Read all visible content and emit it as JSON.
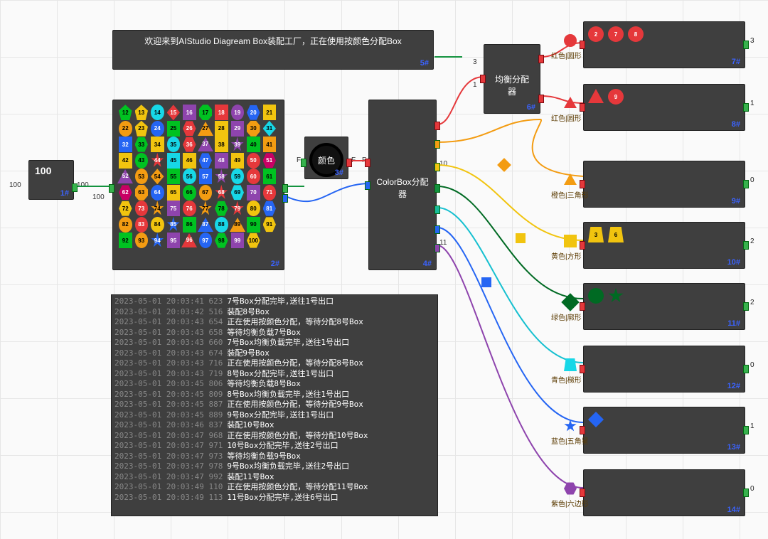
{
  "banner": {
    "text": "欢迎来到AIStudio Diagream Box装配工厂，正在使用按颜色分配Box",
    "id": "5#"
  },
  "source_node": {
    "value": "100",
    "label_left": "100",
    "label_right": "100",
    "port_right_bottom": "100",
    "id": "1#"
  },
  "factory_node": {
    "id": "2#"
  },
  "color_node": {
    "label": "颜色",
    "left_letter": "F",
    "right_letter": "F",
    "left2_letter": "F",
    "id": "3#"
  },
  "distributor": {
    "title": "ColorBox分配器",
    "id": "4#",
    "in_top": "10",
    "in_bottom": "11"
  },
  "balancer": {
    "title": "均衡分配器",
    "id": "6#",
    "in_top": "3",
    "in_bottom": "1"
  },
  "outputs": [
    {
      "id": "7#",
      "label": "红色|圆形",
      "right": "3",
      "marker": "red-circle",
      "shapes": [
        {
          "t": "circle",
          "c": "c-red",
          "n": "2"
        },
        {
          "t": "circle",
          "c": "c-red",
          "n": "7"
        },
        {
          "t": "circle",
          "c": "c-red",
          "n": "8"
        }
      ]
    },
    {
      "id": "8#",
      "label": "红色|圆形",
      "right": "1",
      "marker": "red-triangle",
      "shapes": [
        {
          "t": "triangle-up",
          "c": "c-red",
          "n": ""
        },
        {
          "t": "circle",
          "c": "c-red",
          "n": "9"
        }
      ]
    },
    {
      "id": "9#",
      "label": "橙色|三角形",
      "right": "0",
      "marker": "orange-triangle",
      "shapes": []
    },
    {
      "id": "10#",
      "label": "黄色|方形",
      "right": "2",
      "marker": "yellow-square",
      "shapes": [
        {
          "t": "trapezoid",
          "c": "c-yellow",
          "n": "3"
        },
        {
          "t": "trapezoid",
          "c": "c-yellow",
          "n": "6"
        }
      ]
    },
    {
      "id": "11#",
      "label": "绿色|廓形",
      "right": "2",
      "marker": "darkgreen-diamond",
      "shapes": [
        {
          "t": "circle",
          "c": "c-darkgreen",
          "n": ""
        },
        {
          "t": "star",
          "c": "c-darkgreen",
          "n": ""
        }
      ]
    },
    {
      "id": "12#",
      "label": "青色|梯形",
      "right": "0",
      "marker": "cyan-trapezoid",
      "shapes": []
    },
    {
      "id": "13#",
      "label": "蓝色|五角星",
      "right": "1",
      "marker": "blue-star",
      "shapes": [
        {
          "t": "diamond",
          "c": "c-blue",
          "n": ""
        }
      ]
    },
    {
      "id": "14#",
      "label": "紫色|六边形",
      "right": "0",
      "marker": "purple-hexagon",
      "shapes": []
    }
  ],
  "shape_grid": [
    {
      "t": "pentagon",
      "c": "c-green",
      "n": "12"
    },
    {
      "t": "pentagon",
      "c": "c-yellow",
      "n": "13"
    },
    {
      "t": "circle",
      "c": "c-cyan",
      "n": "14"
    },
    {
      "t": "diamond",
      "c": "c-red",
      "n": "15"
    },
    {
      "t": "square",
      "c": "c-purple",
      "n": "16"
    },
    {
      "t": "octagon",
      "c": "c-green",
      "n": "17"
    },
    {
      "t": "square",
      "c": "c-red",
      "n": "18"
    },
    {
      "t": "circle",
      "c": "c-purple",
      "n": "19"
    },
    {
      "t": "hexagon",
      "c": "c-blue",
      "n": "20"
    },
    {
      "t": "square",
      "c": "c-yellow",
      "n": "21"
    },
    {
      "t": "circle",
      "c": "c-orange",
      "n": "22"
    },
    {
      "t": "pentagon",
      "c": "c-yellow",
      "n": "23"
    },
    {
      "t": "circle",
      "c": "c-blue",
      "n": "24"
    },
    {
      "t": "square",
      "c": "c-green",
      "n": "25"
    },
    {
      "t": "hexagon",
      "c": "c-red",
      "n": "26"
    },
    {
      "t": "triangle-up",
      "c": "c-orange",
      "n": "27"
    },
    {
      "t": "square",
      "c": "c-yellow",
      "n": "28"
    },
    {
      "t": "square",
      "c": "c-purple",
      "n": "29"
    },
    {
      "t": "octagon",
      "c": "c-orange",
      "n": "30"
    },
    {
      "t": "diamond",
      "c": "c-cyan",
      "n": "31"
    },
    {
      "t": "square",
      "c": "c-blue",
      "n": "32"
    },
    {
      "t": "hexagon",
      "c": "c-green",
      "n": "33"
    },
    {
      "t": "square",
      "c": "c-yellow",
      "n": "34"
    },
    {
      "t": "circle",
      "c": "c-cyan",
      "n": "35"
    },
    {
      "t": "hexagon",
      "c": "c-red",
      "n": "36"
    },
    {
      "t": "triangle-up",
      "c": "c-purple",
      "n": "37"
    },
    {
      "t": "square",
      "c": "c-yellow",
      "n": "38"
    },
    {
      "t": "star",
      "c": "c-purple",
      "n": "39"
    },
    {
      "t": "square",
      "c": "c-green",
      "n": "40"
    },
    {
      "t": "square",
      "c": "c-orange",
      "n": "41"
    },
    {
      "t": "square",
      "c": "c-yellow",
      "n": "42"
    },
    {
      "t": "circle",
      "c": "c-green",
      "n": "43"
    },
    {
      "t": "star",
      "c": "c-red",
      "n": "44"
    },
    {
      "t": "square",
      "c": "c-cyan",
      "n": "45"
    },
    {
      "t": "square",
      "c": "c-yellow",
      "n": "46"
    },
    {
      "t": "hexagon",
      "c": "c-blue",
      "n": "47"
    },
    {
      "t": "square",
      "c": "c-purple",
      "n": "48"
    },
    {
      "t": "square",
      "c": "c-yellow",
      "n": "49"
    },
    {
      "t": "circle",
      "c": "c-red",
      "n": "50"
    },
    {
      "t": "hexagon",
      "c": "c-magenta",
      "n": "51"
    },
    {
      "t": "triangle-up",
      "c": "c-purple",
      "n": "52"
    },
    {
      "t": "circle",
      "c": "c-orange",
      "n": "53"
    },
    {
      "t": "diamond",
      "c": "c-orange",
      "n": "54"
    },
    {
      "t": "square",
      "c": "c-green",
      "n": "55"
    },
    {
      "t": "circle",
      "c": "c-cyan",
      "n": "56"
    },
    {
      "t": "square",
      "c": "c-blue",
      "n": "57"
    },
    {
      "t": "star",
      "c": "c-purple",
      "n": "58"
    },
    {
      "t": "circle",
      "c": "c-cyan",
      "n": "59"
    },
    {
      "t": "circle",
      "c": "c-red",
      "n": "60"
    },
    {
      "t": "square",
      "c": "c-green",
      "n": "61"
    },
    {
      "t": "hexagon",
      "c": "c-magenta",
      "n": "62"
    },
    {
      "t": "octagon",
      "c": "c-orange",
      "n": "63"
    },
    {
      "t": "circle",
      "c": "c-blue",
      "n": "64"
    },
    {
      "t": "square",
      "c": "c-yellow",
      "n": "65"
    },
    {
      "t": "circle",
      "c": "c-green",
      "n": "66"
    },
    {
      "t": "circle",
      "c": "c-orange",
      "n": "67"
    },
    {
      "t": "star",
      "c": "c-red",
      "n": "68"
    },
    {
      "t": "hexagon",
      "c": "c-cyan",
      "n": "69"
    },
    {
      "t": "square",
      "c": "c-purple",
      "n": "70"
    },
    {
      "t": "circle",
      "c": "c-red",
      "n": "71"
    },
    {
      "t": "hexagon",
      "c": "c-yellow",
      "n": "72"
    },
    {
      "t": "circle",
      "c": "c-red",
      "n": "73"
    },
    {
      "t": "star",
      "c": "c-orange",
      "n": "74"
    },
    {
      "t": "square",
      "c": "c-purple",
      "n": "75"
    },
    {
      "t": "circle",
      "c": "c-red",
      "n": "76"
    },
    {
      "t": "star",
      "c": "c-orange",
      "n": "77"
    },
    {
      "t": "hexagon",
      "c": "c-green",
      "n": "78"
    },
    {
      "t": "star",
      "c": "c-red",
      "n": "79"
    },
    {
      "t": "circle",
      "c": "c-yellow",
      "n": "80"
    },
    {
      "t": "hexagon",
      "c": "c-blue",
      "n": "81"
    },
    {
      "t": "circle",
      "c": "c-orange",
      "n": "82"
    },
    {
      "t": "circle",
      "c": "c-red",
      "n": "83"
    },
    {
      "t": "circle",
      "c": "c-yellow",
      "n": "84"
    },
    {
      "t": "star",
      "c": "c-blue",
      "n": "85"
    },
    {
      "t": "square",
      "c": "c-green",
      "n": "86"
    },
    {
      "t": "triangle-up",
      "c": "c-blue",
      "n": "87"
    },
    {
      "t": "circle",
      "c": "c-cyan",
      "n": "88"
    },
    {
      "t": "triangle-up",
      "c": "c-orange",
      "n": "89"
    },
    {
      "t": "square",
      "c": "c-green",
      "n": "90"
    },
    {
      "t": "hexagon",
      "c": "c-yellow",
      "n": "91"
    },
    {
      "t": "square",
      "c": "c-green",
      "n": "92"
    },
    {
      "t": "circle",
      "c": "c-orange",
      "n": "93"
    },
    {
      "t": "star",
      "c": "c-blue",
      "n": "94"
    },
    {
      "t": "square",
      "c": "c-purple",
      "n": "95"
    },
    {
      "t": "triangle-up",
      "c": "c-red",
      "n": "96"
    },
    {
      "t": "circle",
      "c": "c-blue",
      "n": "97"
    },
    {
      "t": "hexagon",
      "c": "c-green",
      "n": "98"
    },
    {
      "t": "square",
      "c": "c-purple",
      "n": "99"
    },
    {
      "t": "hexagon",
      "c": "c-yellow",
      "n": "100"
    }
  ],
  "logs": [
    {
      "ts": "2023-05-01 20:03:41 623",
      "msg": "7号Box分配完毕,送往1号出口"
    },
    {
      "ts": "2023-05-01 20:03:42 516",
      "msg": "装配8号Box"
    },
    {
      "ts": "2023-05-01 20:03:43 654",
      "msg": "正在使用按颜色分配，等待分配8号Box"
    },
    {
      "ts": "2023-05-01 20:03:43 658",
      "msg": "等待均衡负载7号Box"
    },
    {
      "ts": "2023-05-01 20:03:43 660",
      "msg": "7号Box均衡负载完毕,送往1号出口"
    },
    {
      "ts": "2023-05-01 20:03:43 674",
      "msg": "装配9号Box"
    },
    {
      "ts": "2023-05-01 20:03:43 716",
      "msg": "正在使用按颜色分配，等待分配8号Box"
    },
    {
      "ts": "2023-05-01 20:03:43 719",
      "msg": "8号Box分配完毕,送往1号出口"
    },
    {
      "ts": "2023-05-01 20:03:45 806",
      "msg": "等待均衡负载8号Box"
    },
    {
      "ts": "2023-05-01 20:03:45 809",
      "msg": "8号Box均衡负载完毕,送往1号出口"
    },
    {
      "ts": "2023-05-01 20:03:45 887",
      "msg": "正在使用按颜色分配，等待分配9号Box"
    },
    {
      "ts": "2023-05-01 20:03:45 889",
      "msg": "9号Box分配完毕,送往1号出口"
    },
    {
      "ts": "2023-05-01 20:03:46 837",
      "msg": "装配10号Box"
    },
    {
      "ts": "2023-05-01 20:03:47 968",
      "msg": "正在使用按颜色分配，等待分配10号Box"
    },
    {
      "ts": "2023-05-01 20:03:47 971",
      "msg": "10号Box分配完毕,送往2号出口"
    },
    {
      "ts": "2023-05-01 20:03:47 973",
      "msg": "等待均衡负载9号Box"
    },
    {
      "ts": "2023-05-01 20:03:47 978",
      "msg": "9号Box均衡负载完毕,送往2号出口"
    },
    {
      "ts": "2023-05-01 20:03:47 992",
      "msg": "装配11号Box"
    },
    {
      "ts": "2023-05-01 20:03:49 110",
      "msg": "正在使用按颜色分配，等待分配11号Box"
    },
    {
      "ts": "2023-05-01 20:03:49 113",
      "msg": "11号Box分配完毕,送往6号出口"
    }
  ]
}
